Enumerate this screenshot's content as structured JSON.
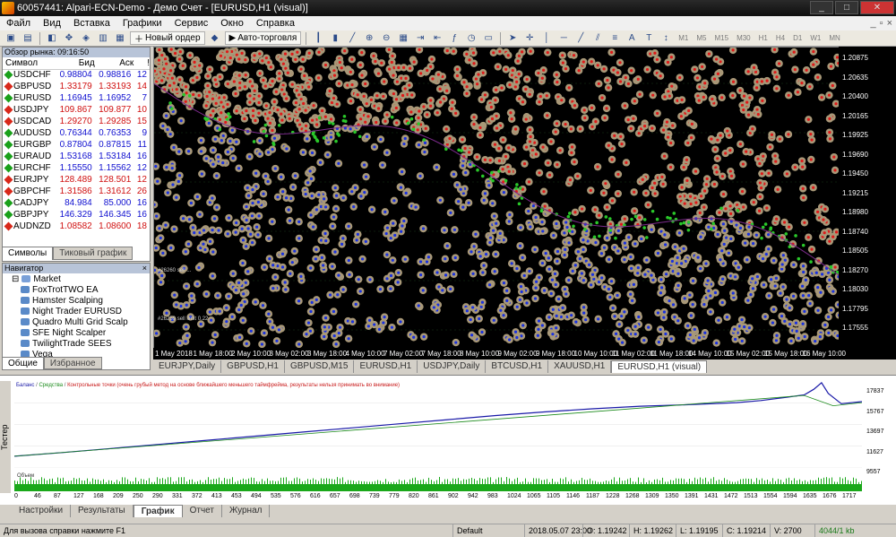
{
  "window": {
    "title": "60057441: Alpari-ECN-Demo - Демо Счет - [EURUSD,H1 (visual)]",
    "controls": [
      "_",
      "□",
      "✕"
    ]
  },
  "menu": [
    "Файл",
    "Вид",
    "Вставка",
    "Графики",
    "Сервис",
    "Окно",
    "Справка"
  ],
  "toolbar": {
    "new_order": "Новый ордер",
    "autotrading": "Авто-торговля",
    "timeframes": [
      "M1",
      "M5",
      "M15",
      "M30",
      "H1",
      "H4",
      "D1",
      "W1",
      "MN"
    ]
  },
  "market_watch": {
    "title": "Обзор рынка: 09:16:50",
    "columns": [
      "Символ",
      "Бид",
      "Аск",
      "!"
    ],
    "rows": [
      {
        "symbol": "USDCHF",
        "bid": "0.98804",
        "ask": "0.98816",
        "spread": "12",
        "dir": "up"
      },
      {
        "symbol": "GBPUSD",
        "bid": "1.33179",
        "ask": "1.33193",
        "spread": "14",
        "dir": "dn"
      },
      {
        "symbol": "EURUSD",
        "bid": "1.16945",
        "ask": "1.16952",
        "spread": "7",
        "dir": "up"
      },
      {
        "symbol": "USDJPY",
        "bid": "109.867",
        "ask": "109.877",
        "spread": "10",
        "dir": "dn"
      },
      {
        "symbol": "USDCAD",
        "bid": "1.29270",
        "ask": "1.29285",
        "spread": "15",
        "dir": "dn"
      },
      {
        "symbol": "AUDUSD",
        "bid": "0.76344",
        "ask": "0.76353",
        "spread": "9",
        "dir": "up"
      },
      {
        "symbol": "EURGBP",
        "bid": "0.87804",
        "ask": "0.87815",
        "spread": "11",
        "dir": "up"
      },
      {
        "symbol": "EURAUD",
        "bid": "1.53168",
        "ask": "1.53184",
        "spread": "16",
        "dir": "up"
      },
      {
        "symbol": "EURCHF",
        "bid": "1.15550",
        "ask": "1.15562",
        "spread": "12",
        "dir": "up"
      },
      {
        "symbol": "EURJPY",
        "bid": "128.489",
        "ask": "128.501",
        "spread": "12",
        "dir": "dn"
      },
      {
        "symbol": "GBPCHF",
        "bid": "1.31586",
        "ask": "1.31612",
        "spread": "26",
        "dir": "dn"
      },
      {
        "symbol": "CADJPY",
        "bid": "84.984",
        "ask": "85.000",
        "spread": "16",
        "dir": "up"
      },
      {
        "symbol": "GBPJPY",
        "bid": "146.329",
        "ask": "146.345",
        "spread": "16",
        "dir": "up"
      },
      {
        "symbol": "AUDNZD",
        "bid": "1.08582",
        "ask": "1.08600",
        "spread": "18",
        "dir": "dn"
      }
    ],
    "tabs": [
      "Символы",
      "Тиковый график"
    ]
  },
  "navigator": {
    "title": "Навигатор",
    "root": "Market",
    "items": [
      "FoxTrotTWO EA",
      "Hamster Scalping",
      "Night Trader EURUSD",
      "Quadro Multi Grid Scalp",
      "SFE Night Scalper",
      "TwilightTrade SEES",
      "Vega"
    ],
    "tabs": [
      "Общие",
      "Избранное"
    ]
  },
  "main_chart": {
    "symbol": "EURUSD,H1",
    "order_labels": [
      "#26260 sell ...",
      "#26259 sell limit 0.22"
    ],
    "price_ticks": [
      "1.20875",
      "1.20635",
      "1.20400",
      "1.20165",
      "1.19925",
      "1.19690",
      "1.19450",
      "1.19215",
      "1.18980",
      "1.18740",
      "1.18505",
      "1.18270",
      "1.18030",
      "1.17795",
      "1.17555"
    ],
    "time_ticks": [
      "1 May 2018",
      "1 May 18:00",
      "2 May 10:00",
      "3 May 02:00",
      "3 May 18:00",
      "4 May 10:00",
      "7 May 02:00",
      "7 May 18:00",
      "8 May 10:00",
      "9 May 02:00",
      "9 May 18:00",
      "10 May 10:00",
      "11 May 02:00",
      "11 May 18:00",
      "14 May 10:00",
      "15 May 02:00",
      "15 May 18:00",
      "16 May 10:00"
    ],
    "tabs": [
      "EURJPY,Daily",
      "GBPUSD,H1",
      "GBPUSD,M15",
      "EURUSD,H1",
      "USDJPY,Daily",
      "BTCUSD,H1",
      "XAUUSD,H1",
      "EURUSD,H1 (visual)"
    ]
  },
  "tester": {
    "legend_balance": "Баланс",
    "legend_equity": "Средства",
    "legend_note": "Контрольные точки (очень грубый метод на основе ближайшего меньшего таймфрейма, результаты нельзя принимать во внимание)",
    "volume_label": "Объем",
    "side_label": "Тестер",
    "tabs": [
      "Настройки",
      "Результаты",
      "График",
      "Отчет",
      "Журнал"
    ]
  },
  "chart_data": {
    "type": "line",
    "title": "",
    "ylim": [
      9557,
      18000
    ],
    "y_ticks": [
      "17837",
      "15767",
      "13697",
      "11627",
      "9557"
    ],
    "x_ticks": [
      "0",
      "46",
      "87",
      "127",
      "168",
      "209",
      "250",
      "290",
      "331",
      "372",
      "413",
      "453",
      "494",
      "535",
      "576",
      "616",
      "657",
      "698",
      "739",
      "779",
      "820",
      "861",
      "902",
      "942",
      "983",
      "1024",
      "1065",
      "1105",
      "1146",
      "1187",
      "1228",
      "1268",
      "1309",
      "1350",
      "1391",
      "1431",
      "1472",
      "1513",
      "1554",
      "1594",
      "1635",
      "1676",
      "1717"
    ],
    "series": [
      {
        "name": "Баланс",
        "x": [
          0,
          100,
          200,
          300,
          400,
          500,
          600,
          700,
          800,
          900,
          1000,
          1100,
          1200,
          1300,
          1400,
          1500,
          1550,
          1600,
          1640,
          1660,
          1676,
          1690,
          1717,
          1760
        ],
        "values": [
          10700,
          11050,
          11450,
          11850,
          12250,
          12650,
          13050,
          13450,
          13850,
          14250,
          14650,
          15000,
          15300,
          15550,
          15700,
          15900,
          16100,
          16400,
          16650,
          17200,
          17837,
          16800,
          15800,
          16000
        ]
      },
      {
        "name": "Средства",
        "x": [
          0,
          1640,
          1700,
          1760
        ],
        "values": [
          10700,
          16600,
          15600,
          15900
        ]
      }
    ]
  },
  "status": {
    "help": "Для вызова справки нажмите F1",
    "profile": "Default",
    "datetime": "2018.05.07 23:00",
    "open": "O: 1.19242",
    "high": "H: 1.19262",
    "low": "L: 1.19195",
    "close": "C: 1.19214",
    "volume": "V: 2700",
    "traffic": "4044/1 kb"
  }
}
